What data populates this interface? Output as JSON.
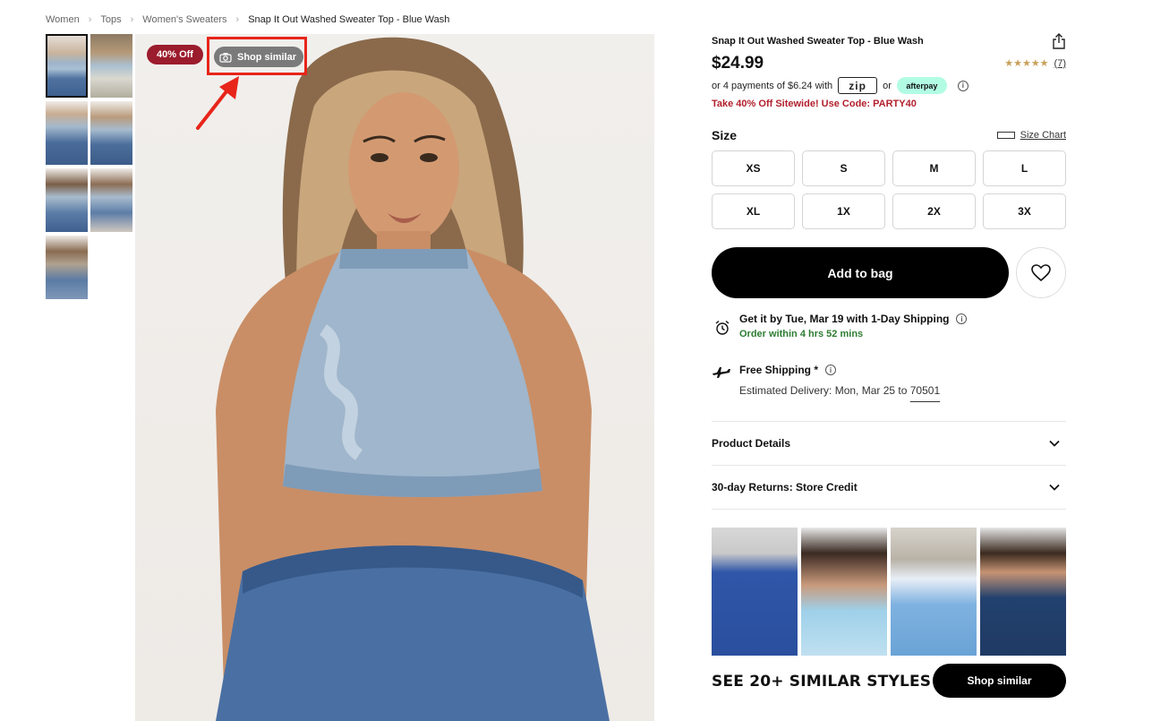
{
  "breadcrumb": {
    "items": [
      "Women",
      "Tops",
      "Women's Sweaters",
      "Snap It Out Washed Sweater Top - Blue Wash"
    ]
  },
  "gallery": {
    "thumbnail_count": 7,
    "badge": "40% Off",
    "shop_similar_label": "Shop similar"
  },
  "product": {
    "title": "Snap It Out Washed Sweater Top - Blue Wash",
    "price": "$24.99",
    "rating_stars": "★★★★★",
    "rating_value": 4.5,
    "review_count": "(7)",
    "payments_text": "or 4 payments of $6.24 with",
    "payments_or": "or",
    "zip_logo": "zip",
    "afterpay_logo": "afterpay",
    "promo": "Take 40% Off Sitewide! Use Code: PARTY40"
  },
  "size": {
    "label": "Size",
    "chart_label": "Size Chart",
    "options": [
      "XS",
      "S",
      "M",
      "L",
      "XL",
      "1X",
      "2X",
      "3X"
    ]
  },
  "actions": {
    "add_to_bag": "Add to bag",
    "wishlist_icon": "heart-icon"
  },
  "shipping": {
    "delivery_line": "Get it by Tue, Mar 19 with 1-Day Shipping",
    "order_within": "Order within 4 hrs 52 mins",
    "free_shipping": "Free Shipping *",
    "estimated_prefix": "Estimated Delivery: Mon, Mar 25 to",
    "zipcode": "70501"
  },
  "accordions": {
    "details": "Product Details",
    "returns": "30-day Returns: Store Credit"
  },
  "similar": {
    "title": "SEE 20+ SIMILAR STYLES",
    "button": "Shop similar"
  },
  "colors": {
    "promo_red": "#b2202d",
    "badge_red": "#9b1c2c",
    "highlight_red": "#e8251a",
    "green": "#2e7d32",
    "star_gold": "#c8a15a",
    "afterpay_mint": "#b2fce4"
  }
}
